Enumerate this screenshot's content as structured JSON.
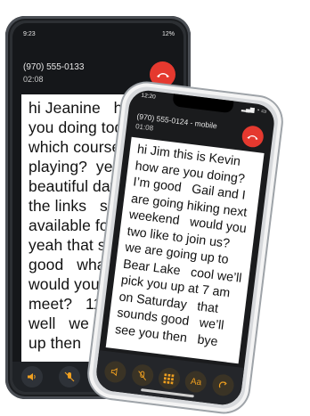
{
  "android": {
    "status_time": "9:23",
    "status_right": "12%",
    "caller_number": "(970) 555-0133",
    "call_duration": "02:08",
    "transcript": "hi Jeanine   how are\nyou doing today?\nwhich course are y\nplaying?  yes it’s s\nbeautiful day to h\nthe links   sure I’r\navailable for lunc\nyeah that sounds\ngood   what tim\nwould you like\nmeet?   11:45\nwell   we can\nup then",
    "buttons": [
      "speaker-icon",
      "mute-icon",
      "keypad-icon"
    ]
  },
  "iphone": {
    "status_time": "12:20",
    "caller_number": "(970) 555-0124 - mobile",
    "call_duration": "01:08",
    "transcript": "hi Jim this is Kevin\nhow are you doing?\nI’m good   Gail and I\nare going hiking next\nweekend   would you\ntwo like to join us?\nwe are going up to\nBear Lake   cool we’ll\npick you up at 7 am\non Saturday   that\nsounds good   we’ll\nsee you then   bye",
    "buttons": [
      "speaker-icon",
      "mute-icon",
      "keypad-icon",
      "text-size-icon",
      "redial-icon"
    ],
    "text_size_label": "Aa"
  },
  "colors": {
    "hangup": "#e5392f",
    "accent": "#f0a020"
  }
}
